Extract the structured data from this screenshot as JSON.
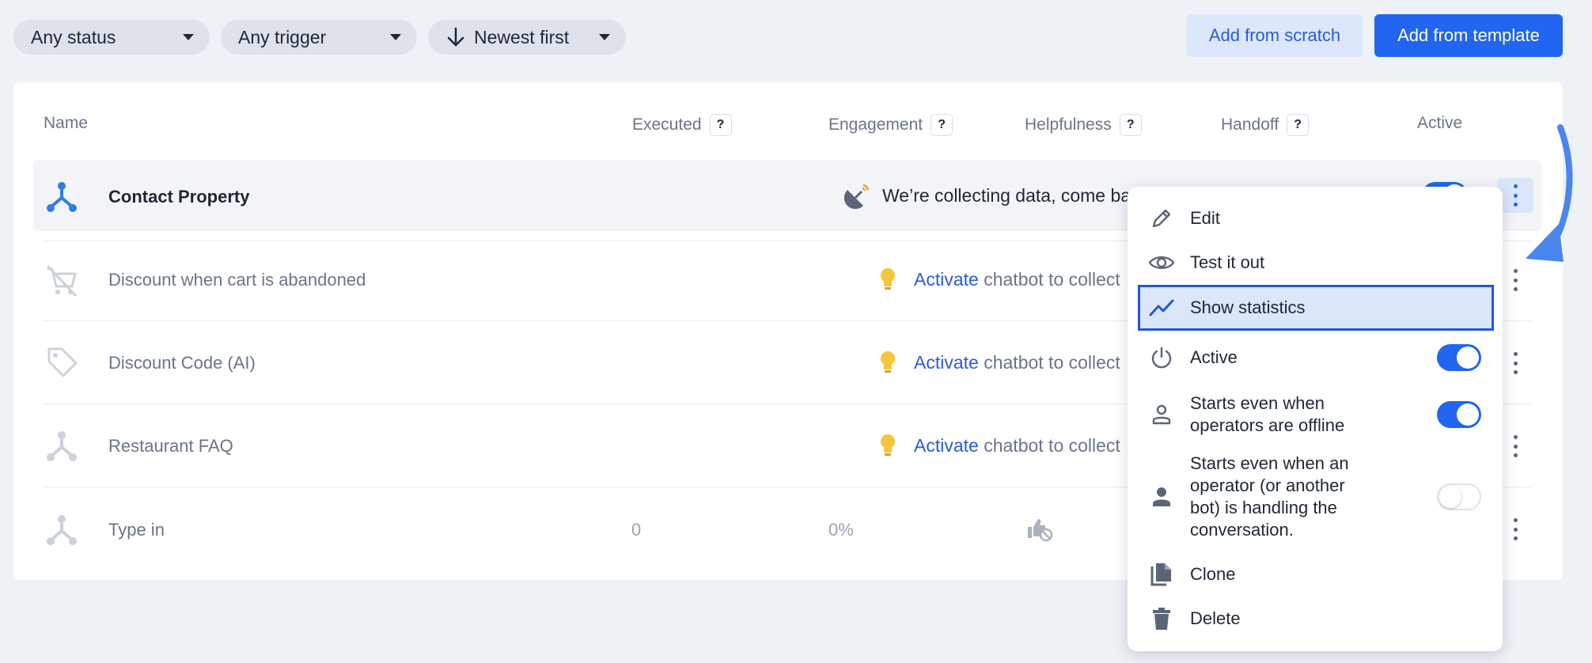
{
  "filters": {
    "status": "Any status",
    "trigger": "Any trigger",
    "sort": "Newest first"
  },
  "actions": {
    "add_scratch": "Add from scratch",
    "add_template": "Add from template"
  },
  "table": {
    "columns": {
      "name": "Name",
      "executed": "Executed",
      "engagement": "Engagement",
      "helpfulness": "Helpfulness",
      "handoff": "Handoff",
      "active": "Active"
    },
    "help_glyph": "?",
    "rows": [
      {
        "name": "Contact Property",
        "engagement": "We’re collecting data, come ba",
        "icon": "flow-icon"
      },
      {
        "name": "Discount when cart is abandoned",
        "engagement_link": "Activate",
        "engagement_text": "chatbot to collect",
        "icon": "cart-off-icon"
      },
      {
        "name": "Discount Code (AI)",
        "engagement_link": "Activate",
        "engagement_text": "chatbot to collect",
        "icon": "tag-icon"
      },
      {
        "name": "Restaurant FAQ",
        "engagement_link": "Activate",
        "engagement_text": "chatbot to collect",
        "icon": "flow-icon"
      },
      {
        "name": "Type in",
        "executed": "0",
        "engagement_value": "0%",
        "icon": "flow-icon"
      }
    ]
  },
  "menu": {
    "items": [
      {
        "label": "Edit",
        "icon": "pencil-icon"
      },
      {
        "label": "Test it out",
        "icon": "eye-icon"
      },
      {
        "label": "Show statistics",
        "icon": "trend-icon",
        "selected": true
      },
      {
        "label": "Active",
        "icon": "power-icon",
        "toggle": true
      },
      {
        "label": "Starts even when operators are offline",
        "icon": "person-outline-icon",
        "toggle": true
      },
      {
        "label": "Starts even when an operator (or another bot) is handling the conversation.",
        "icon": "person-filled-icon",
        "toggle": false
      },
      {
        "label": "Clone",
        "icon": "copy-icon"
      },
      {
        "label": "Delete",
        "icon": "trash-icon"
      }
    ]
  },
  "colors": {
    "accent": "#2165f0",
    "background": "#eef1f6",
    "selected_bg": "#dbe6fb"
  }
}
